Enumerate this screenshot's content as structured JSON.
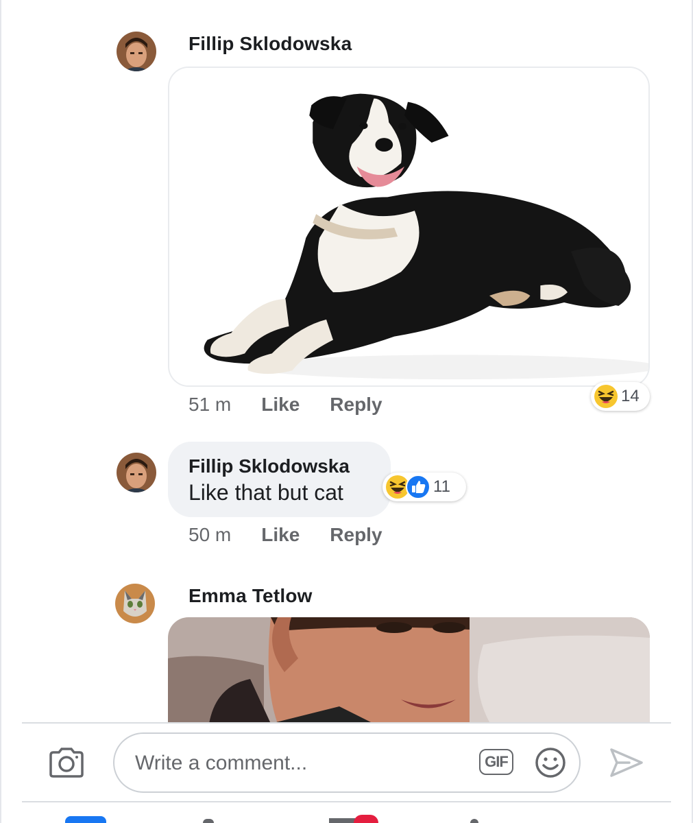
{
  "comments": [
    {
      "author": "Fillip Sklodowska",
      "avatar_icon": "avatar-man-icon",
      "attachment": "dog-photo",
      "time": "51 m",
      "like_label": "Like",
      "reply_label": "Reply",
      "reactions": {
        "icons": [
          "haha-emoji-icon"
        ],
        "count": "14"
      }
    },
    {
      "author": "Fillip Sklodowska",
      "avatar_icon": "avatar-man-icon",
      "text": "Like that but cat",
      "time": "50 m",
      "like_label": "Like",
      "reply_label": "Reply",
      "reactions": {
        "icons": [
          "haha-emoji-icon",
          "like-thumb-icon"
        ],
        "count": "11"
      }
    },
    {
      "author": "Emma Tetlow",
      "avatar_icon": "avatar-cat-icon",
      "attachment": "gif-image"
    }
  ],
  "composer": {
    "placeholder": "Write a comment...",
    "gif_label": "GIF",
    "camera_icon": "camera-icon",
    "emoji_icon": "smiley-icon",
    "send_icon": "send-icon"
  },
  "colors": {
    "like_blue": "#1877f2",
    "haha_yellow": "#f7c62f",
    "meta_gray": "#65676b",
    "bubble_bg": "#f0f2f5",
    "notification_red": "#e41e3f"
  }
}
